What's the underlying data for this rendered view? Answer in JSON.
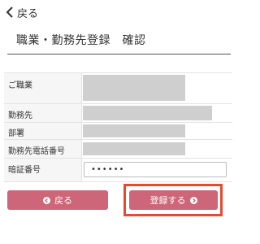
{
  "topbar": {
    "back_label": "戻る"
  },
  "page": {
    "title": "職業・勤務先登録　確認"
  },
  "form": {
    "rows": [
      {
        "label": "ご職業"
      },
      {
        "label": "勤務先"
      },
      {
        "label": "部署"
      },
      {
        "label": "勤務先電話番号"
      },
      {
        "label": "暗証番号",
        "value": "••••••"
      }
    ]
  },
  "buttons": {
    "back_label": "戻る",
    "submit_label": "登録する"
  },
  "colors": {
    "button": "#cc6678",
    "highlight": "#e84a2f",
    "mask": "#cfcfcf"
  }
}
